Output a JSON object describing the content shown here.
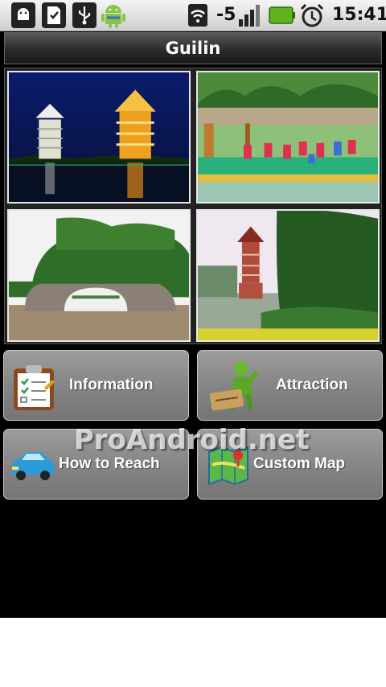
{
  "status_bar": {
    "signal_text": "-5",
    "time": "15:41",
    "icons": [
      "android-debug-icon",
      "sd-card-icon",
      "usb-icon",
      "android-robot-icon",
      "wifi-icon",
      "signal-icon",
      "battery-icon",
      "alarm-icon"
    ]
  },
  "header": {
    "title": "Guilin"
  },
  "gallery": {
    "photos": [
      {
        "name": "twin-pagodas-night"
      },
      {
        "name": "folk-dance-performance"
      },
      {
        "name": "elephant-trunk-hill"
      },
      {
        "name": "pagoda-by-lake"
      }
    ]
  },
  "menu": {
    "information": "Information",
    "attraction": "Attraction",
    "how_to_reach": "How to Reach",
    "custom_map": "Custom Map"
  },
  "watermark": "ProAndroid.net",
  "colors": {
    "background": "#000000",
    "button": "#8a8a8a",
    "title_bar": "#3a3a3a"
  }
}
